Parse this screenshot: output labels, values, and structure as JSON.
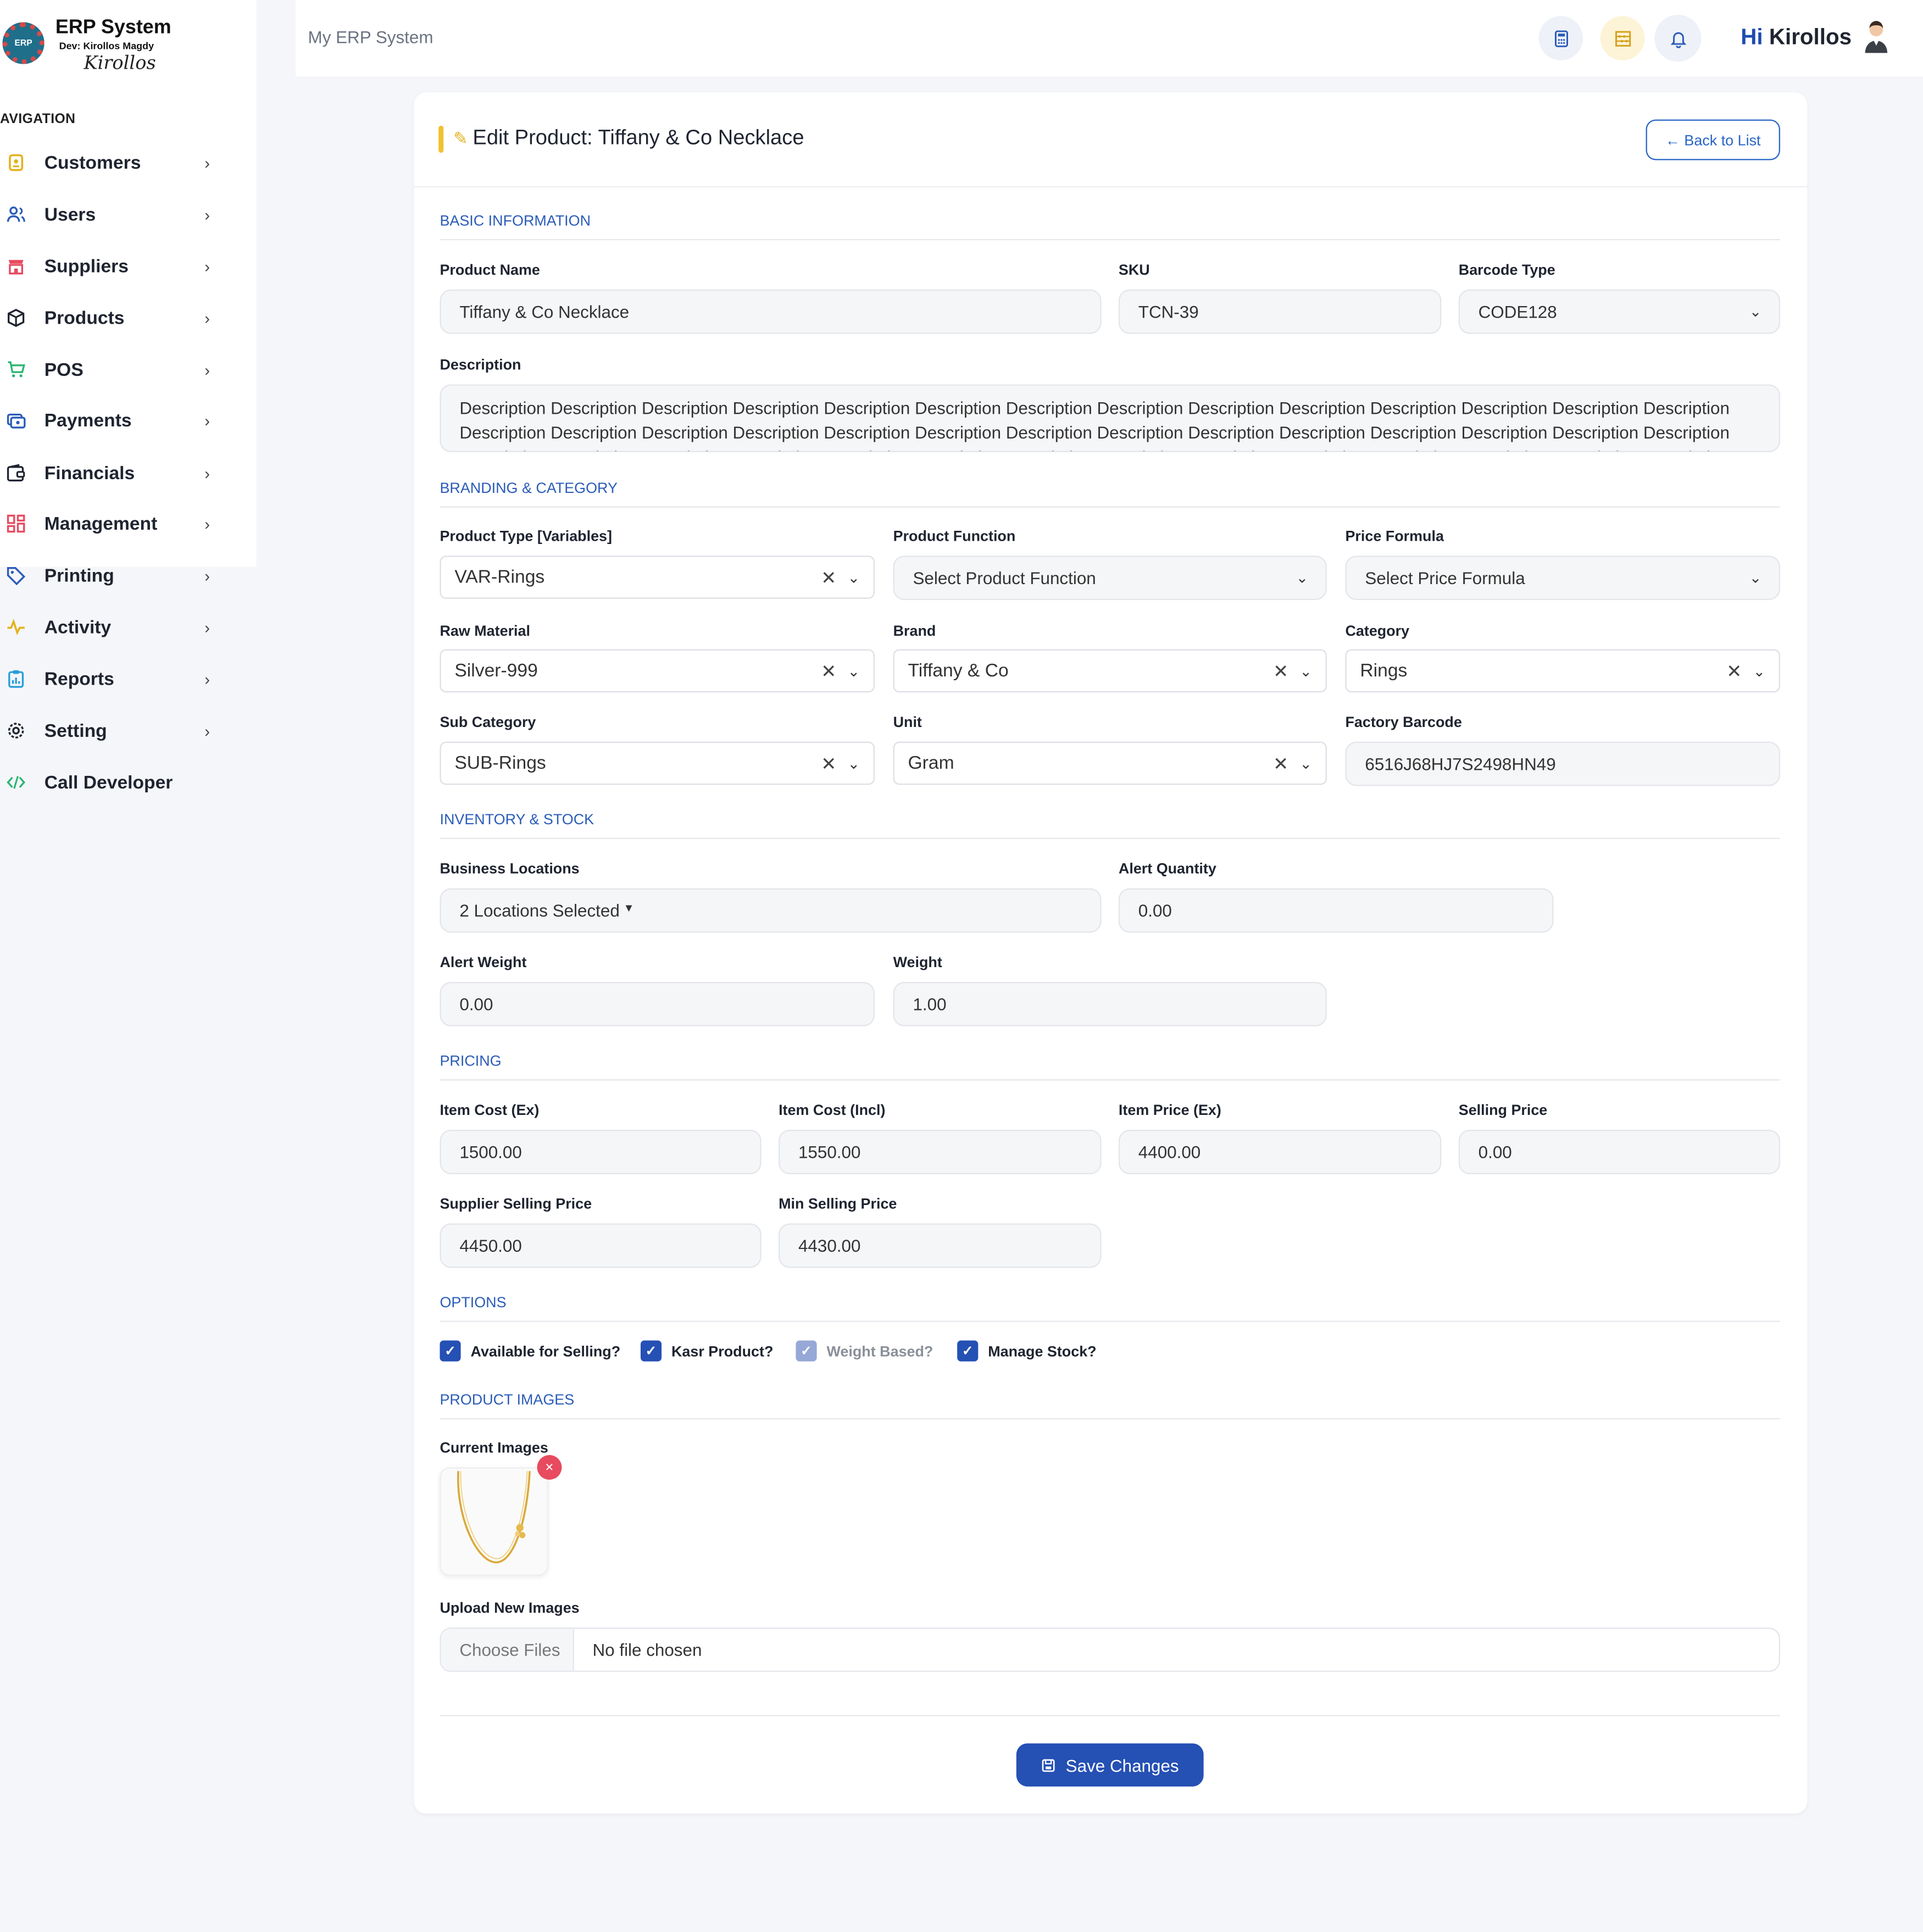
{
  "logo": {
    "title": "ERP System",
    "dev": "Dev: Kirollos Magdy",
    "signature": "Kirollos",
    "badge": "ERP"
  },
  "sidebar": {
    "title": "AVIGATION",
    "items": [
      {
        "label": "Customers",
        "icon": "customers-icon"
      },
      {
        "label": "Users",
        "icon": "users-icon"
      },
      {
        "label": "Suppliers",
        "icon": "suppliers-icon"
      },
      {
        "label": "Products",
        "icon": "products-icon"
      },
      {
        "label": "POS",
        "icon": "pos-icon"
      },
      {
        "label": "Payments",
        "icon": "payments-icon"
      },
      {
        "label": "Financials",
        "icon": "financials-icon"
      },
      {
        "label": "Management",
        "icon": "management-icon"
      },
      {
        "label": "Printing",
        "icon": "printing-icon"
      },
      {
        "label": "Activity",
        "icon": "activity-icon"
      },
      {
        "label": "Reports",
        "icon": "reports-icon"
      },
      {
        "label": "Setting",
        "icon": "setting-icon"
      },
      {
        "label": "Call Developer",
        "icon": "code-icon"
      }
    ]
  },
  "topbar": {
    "title": "My ERP System",
    "greeting_hi": "Hi",
    "user_name": "Kirollos"
  },
  "page": {
    "title": "Edit Product: Tiffany & Co Necklace",
    "back_label": "← Back to List"
  },
  "sections": {
    "basic": "BASIC INFORMATION",
    "branding": "BRANDING & CATEGORY",
    "inventory": "INVENTORY & STOCK",
    "pricing": "PRICING",
    "options": "OPTIONS",
    "images": "PRODUCT IMAGES"
  },
  "basic": {
    "product_name_label": "Product Name",
    "product_name": "Tiffany & Co Necklace",
    "sku_label": "SKU",
    "sku": "TCN-39",
    "barcode_type_label": "Barcode Type",
    "barcode_type": "CODE128",
    "description_label": "Description",
    "description": "Description Description Description Description Description Description Description Description Description Description Description Description Description Description Description Description Description Description Description Description Description Description Description Description Description Description Description Description Description Description Description Description Description Description Description Description Description Description Description Description Description Description Description Description Description Description Description Description Description Description"
  },
  "branding": {
    "product_type_label": "Product Type [Variables]",
    "product_type": "VAR-Rings",
    "product_function_label": "Product Function",
    "product_function": "Select Product Function",
    "price_formula_label": "Price Formula",
    "price_formula": "Select Price Formula",
    "raw_material_label": "Raw Material",
    "raw_material": "Silver-999",
    "brand_label": "Brand",
    "brand": "Tiffany & Co",
    "category_label": "Category",
    "category": "Rings",
    "sub_category_label": "Sub Category",
    "sub_category": "SUB-Rings",
    "unit_label": "Unit",
    "unit": "Gram",
    "factory_barcode_label": "Factory Barcode",
    "factory_barcode": "6516J68HJ7S2498HN49"
  },
  "inventory": {
    "locations_label": "Business Locations",
    "locations": "2 Locations Selected",
    "alert_qty_label": "Alert Quantity",
    "alert_qty": "0.00",
    "alert_weight_label": "Alert Weight",
    "alert_weight": "0.00",
    "weight_label": "Weight",
    "weight": "1.00"
  },
  "pricing": {
    "item_cost_ex_label": "Item Cost (Ex)",
    "item_cost_ex": "1500.00",
    "item_cost_incl_label": "Item Cost (Incl)",
    "item_cost_incl": "1550.00",
    "item_price_ex_label": "Item Price (Ex)",
    "item_price_ex": "4400.00",
    "selling_price_label": "Selling Price",
    "selling_price": "0.00",
    "supplier_selling_label": "Supplier Selling Price",
    "supplier_selling": "4450.00",
    "min_selling_label": "Min Selling Price",
    "min_selling": "4430.00"
  },
  "options": {
    "available": "Available for Selling?",
    "kasr": "Kasr Product?",
    "weight_based": "Weight Based?",
    "manage_stock": "Manage Stock?"
  },
  "images": {
    "current_label": "Current Images",
    "upload_label": "Upload New Images",
    "choose_files": "Choose Files",
    "no_file": "No file chosen"
  },
  "save_label": "Save Changes",
  "colors": {
    "primary": "#2550b4",
    "accent": "#f2c12e",
    "section": "#2a5bb8",
    "danger": "#e84a5f"
  }
}
